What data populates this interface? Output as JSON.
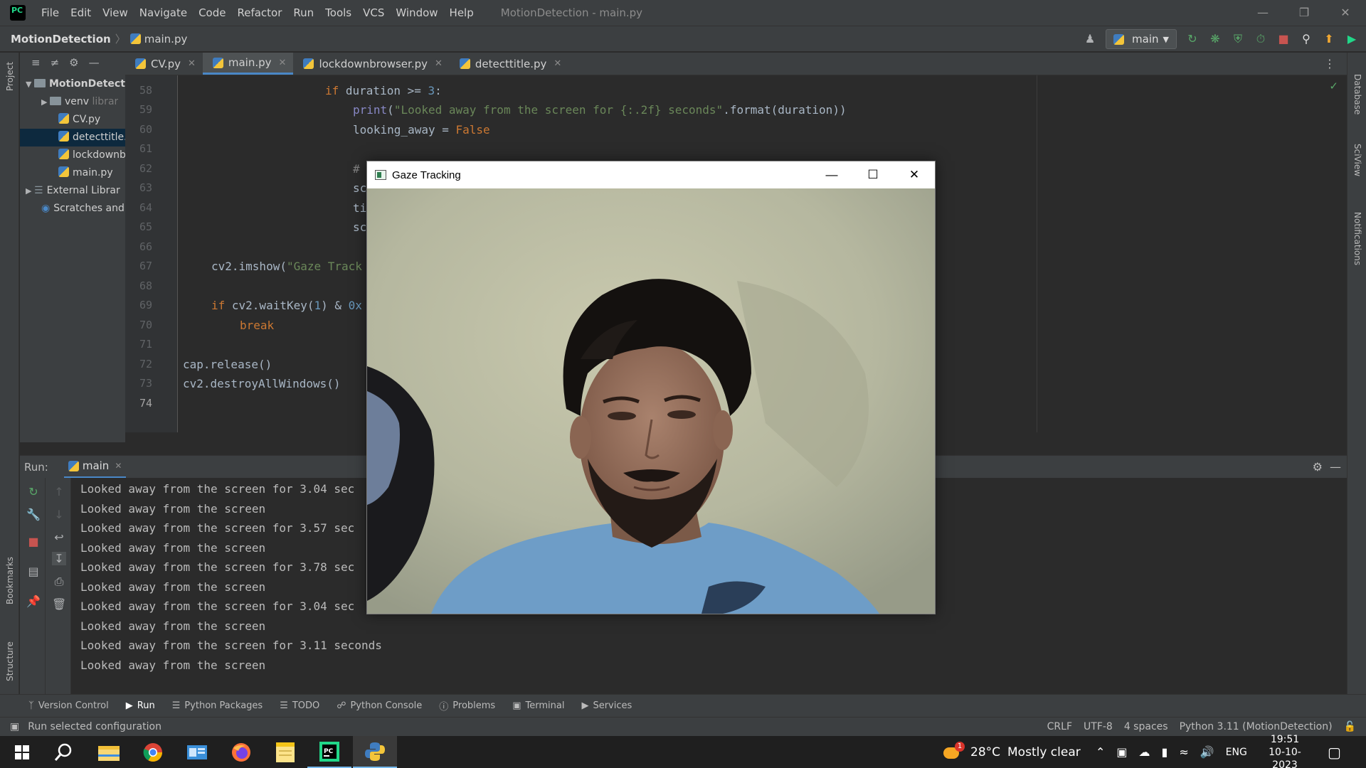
{
  "window": {
    "title": "MotionDetection - main.py",
    "menu": [
      "File",
      "Edit",
      "View",
      "Navigate",
      "Code",
      "Refactor",
      "Run",
      "Tools",
      "VCS",
      "Window",
      "Help"
    ]
  },
  "navbar": {
    "project": "MotionDetection",
    "file": "main.py",
    "run_config": "main"
  },
  "project_tree": {
    "root": "MotionDetect",
    "venv": "venv",
    "venv_suffix": "librar",
    "files": [
      "CV.py",
      "detecttitle.",
      "lockdownb",
      "main.py"
    ],
    "external": "External Librar",
    "scratches": "Scratches and"
  },
  "tabs": [
    {
      "label": "CV.py"
    },
    {
      "label": "main.py"
    },
    {
      "label": "lockdownbrowser.py"
    },
    {
      "label": "detecttitle.py"
    }
  ],
  "editor": {
    "line_numbers": [
      "58",
      "59",
      "60",
      "61",
      "62",
      "63",
      "64",
      "65",
      "66",
      "67",
      "68",
      "69",
      "70",
      "71",
      "72",
      "73",
      "74"
    ],
    "code": {
      "l58_kw": "if",
      "l58_rest": " duration >= ",
      "l58_num": "3",
      "l58_end": ":",
      "l59_fn": "print",
      "l59_p": "(",
      "l59_str": "\"Looked away from the screen for {:.2f} seconds\"",
      "l59_rest": ".format(duration))",
      "l60_rest": "looking_away = ",
      "l60_kw": "False",
      "l62": "#",
      "l63": "sc",
      "l64": "ti",
      "l65": "sc",
      "l67_a": "cv2.imshow(",
      "l67_str": "\"Gaze Track",
      "l69_kw": "if",
      "l69_rest": " cv2.waitKey(",
      "l69_num": "1",
      "l69_rest2": ") & ",
      "l69_hex": "0x",
      "l70_kw": "break",
      "l72": "cap.release()",
      "l73": "cv2.destroyAllWindows()"
    }
  },
  "run_panel": {
    "label": "Run:",
    "tab": "main",
    "output": [
      "Looked away from the screen for 3.04 sec",
      "Looked away from the screen",
      "Looked away from the screen for 3.57 sec",
      "Looked away from the screen",
      "Looked away from the screen for 3.78 sec",
      "Looked away from the screen",
      "Looked away from the screen for 3.04 sec",
      "Looked away from the screen",
      "Looked away from the screen for 3.11 seconds",
      "Looked away from the screen"
    ]
  },
  "side_labels": {
    "project": "Project",
    "bookmarks": "Bookmarks",
    "structure": "Structure",
    "database": "Database",
    "sciview": "SciView",
    "notifications": "Notifications"
  },
  "bottom_tabs": [
    "Version Control",
    "Run",
    "Python Packages",
    "TODO",
    "Python Console",
    "Problems",
    "Terminal",
    "Services"
  ],
  "status": {
    "message": "Run selected configuration",
    "line_sep": "CRLF",
    "encoding": "UTF-8",
    "indent": "4 spaces",
    "interpreter": "Python 3.11 (MotionDetection)"
  },
  "gaze_window": {
    "title": "Gaze Tracking"
  },
  "taskbar": {
    "weather_badge": "1",
    "temperature": "28°C",
    "weather": "Mostly clear",
    "language": "ENG",
    "time": "19:51",
    "date": "10-10-2023"
  },
  "colors": {
    "ide_bg": "#2b2b2b",
    "panel_bg": "#3c3f41",
    "keyword": "#cc7832",
    "string": "#6a8759",
    "number": "#6897bb",
    "accent": "#4a88c7"
  }
}
